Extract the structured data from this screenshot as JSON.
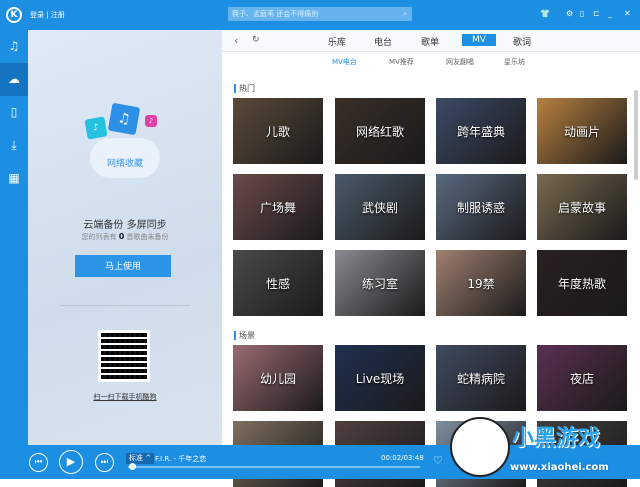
{
  "topbar": {
    "login": "登录 | 注册",
    "search_placeholder": "筷子、孟庭苇 还会不得痛别"
  },
  "rail": [
    "♫",
    "☁",
    "▯",
    "⤓",
    "▦"
  ],
  "left": {
    "cloud_label": "网络收藏",
    "headline": "云端备份 多屏同步",
    "sub_pre": "您的列表有",
    "sub_count": "0",
    "sub_post": "首歌曲未备份",
    "button": "马上使用",
    "qr_text": "扫一扫下载手机酷狗"
  },
  "nav": {
    "tabs": [
      "乐库",
      "电台",
      "歌单",
      "MV",
      "歌词"
    ],
    "active": "MV",
    "subtabs": [
      "MV电台",
      "MV推荐",
      "网友翻唱",
      "星乐坊"
    ]
  },
  "sections": [
    {
      "title": "热门",
      "tiles": [
        "儿歌",
        "网络红歌",
        "跨年盛典",
        "动画片",
        "广场舞",
        "武侠剧",
        "制服诱惑",
        "启蒙故事",
        "性感",
        "练习室",
        "19禁",
        "年度热歌"
      ]
    },
    {
      "title": "场景",
      "tiles": [
        "幼儿园",
        "Live现场",
        "蛇精病院",
        "夜店",
        "",
        "",
        "",
        ""
      ]
    }
  ],
  "player": {
    "quality": "标准 ^",
    "song": "F.I.R. - 千年之恋",
    "time": "00:02/03:48",
    "progress": 0.01
  },
  "watermark": {
    "brand": "小黑游戏",
    "url": "www.xiaohei.com"
  }
}
